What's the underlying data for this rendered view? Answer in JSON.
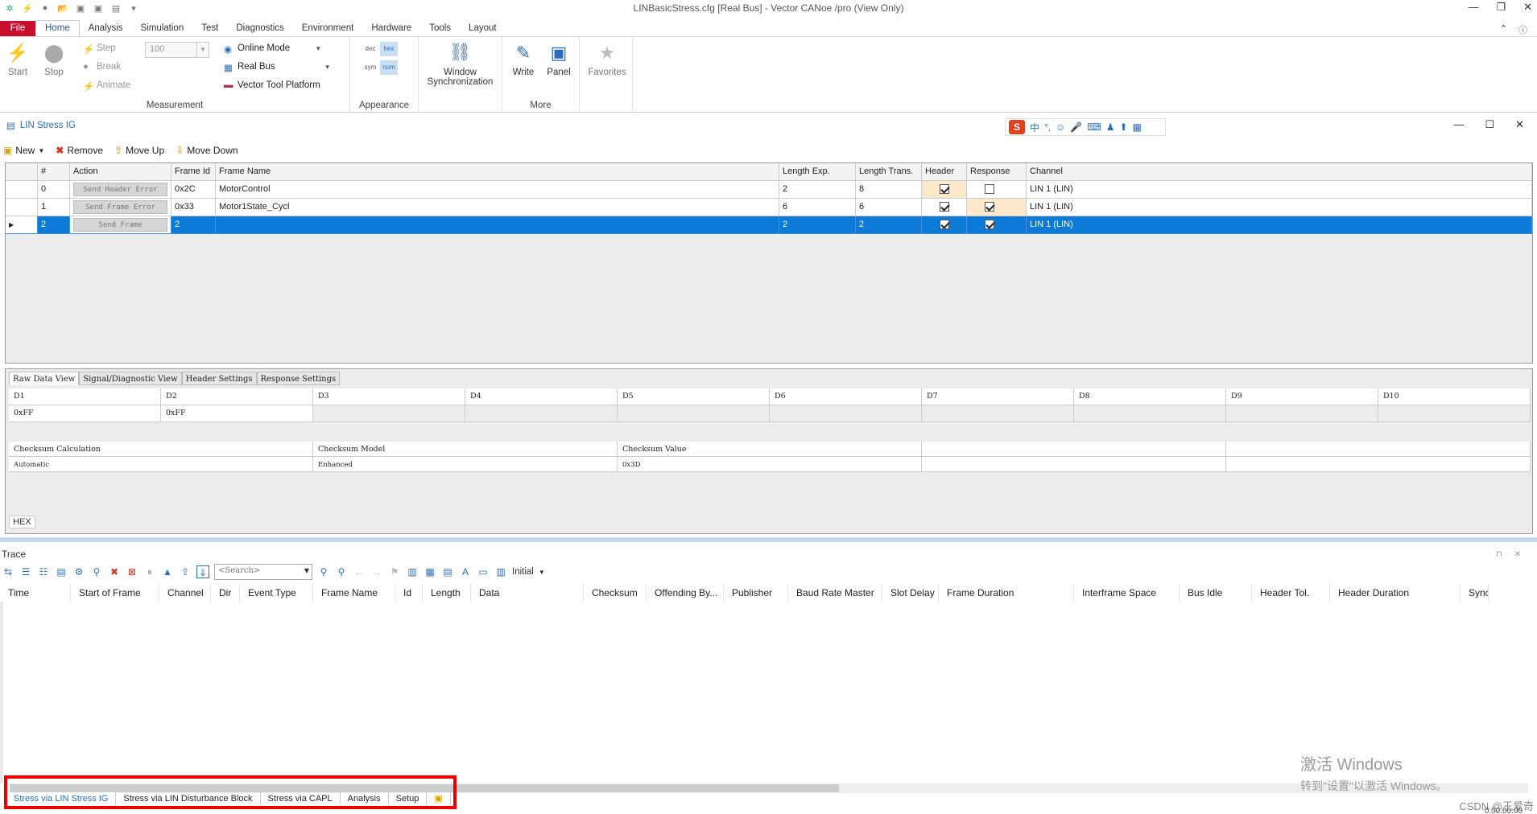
{
  "app": {
    "title": "LINBasicStress.cfg [Real Bus] - Vector CANoe /pro (View Only)",
    "window_controls": [
      "—",
      "❐",
      "✕"
    ]
  },
  "ribbon": {
    "file_tab": "File",
    "tabs": [
      "Home",
      "Analysis",
      "Simulation",
      "Test",
      "Diagnostics",
      "Environment",
      "Hardware",
      "Tools",
      "Layout"
    ],
    "active_tab": "Home",
    "measurement": {
      "start": "Start",
      "stop": "Stop",
      "step": "Step",
      "break": "Break",
      "animate": "Animate",
      "speed_value": "100",
      "online_mode": "Online Mode",
      "real_bus": "Real Bus",
      "vector_tool_platform": "Vector Tool Platform",
      "label": "Measurement"
    },
    "appearance": {
      "dec": "dec",
      "hex": "hex",
      "sym": "sym",
      "num": "num",
      "label": "Appearance"
    },
    "window_sync": {
      "line1": "Window",
      "line2": "Synchronization"
    },
    "more": {
      "write": "Write",
      "panel": "Panel",
      "label": "More"
    },
    "favorites": "Favorites"
  },
  "ig": {
    "title": "LIN Stress IG",
    "toolbar": {
      "new": "New",
      "remove": "Remove",
      "move_up": "Move Up",
      "move_down": "Move Down"
    },
    "columns": [
      "#",
      "Action",
      "Frame Id",
      "Frame Name",
      "Length Exp.",
      "Length Trans.",
      "Header",
      "Response",
      "Channel"
    ],
    "rows": [
      {
        "num": "0",
        "action": "Send Header Error",
        "frame_id": "0x2C",
        "frame_name": "MotorControl",
        "len_exp": "2",
        "len_trans": "8",
        "header": true,
        "response": false,
        "channel": "LIN 1 (LIN)"
      },
      {
        "num": "1",
        "action": "Send Frame Error",
        "frame_id": "0x33",
        "frame_name": "Motor1State_Cycl",
        "len_exp": "6",
        "len_trans": "6",
        "header": true,
        "response": true,
        "channel": "LIN 1 (LIN)"
      },
      {
        "num": "2",
        "action": "Send Frame",
        "frame_id": "2",
        "frame_name": "",
        "len_exp": "2",
        "len_trans": "2",
        "header": true,
        "response": true,
        "channel": "LIN 1 (LIN)"
      }
    ],
    "selected_row": 2
  },
  "detail": {
    "tabs": [
      "Raw Data View",
      "Signal/Diagnostic View",
      "Header Settings",
      "Response Settings"
    ],
    "active_tab": "Raw Data View",
    "data_headers": [
      "D1",
      "D2",
      "D3",
      "D4",
      "D5",
      "D6",
      "D7",
      "D8",
      "D9",
      "D10"
    ],
    "data_values": [
      "0xFF",
      "0xFF",
      "",
      "",
      "",
      "",
      "",
      "",
      "",
      ""
    ],
    "checksum_headers": [
      "Checksum Calculation",
      "Checksum Model",
      "Checksum Value"
    ],
    "checksum_values": [
      "Automatic",
      "Enhanced",
      "0x3D"
    ],
    "format": "HEX"
  },
  "trace": {
    "title": "Trace",
    "search_placeholder": "<Search>",
    "initial": "Initial",
    "columns": [
      "Time",
      "Start of Frame",
      "Channel",
      "Dir",
      "Event Type",
      "Frame Name",
      "Id",
      "Length",
      "Data",
      "Checksum",
      "Offending By...",
      "Publisher",
      "Baud Rate Master",
      "Slot Delay",
      "Frame Duration",
      "Interframe Space",
      "Bus Idle",
      "Header Tol.",
      "Header Duration",
      "Sync Br"
    ]
  },
  "bottom_tabs": [
    "Stress via LIN Stress IG",
    "Stress via LIN Disturbance Block",
    "Stress via CAPL",
    "Analysis",
    "Setup"
  ],
  "active_bottom_tab": "Stress via LIN Stress IG",
  "watermark": {
    "line1": "激活 Windows",
    "line2": "转到\"设置\"以激活 Windows。"
  },
  "csdn": "CSDN @王爱奇",
  "status_time": "0:00:00:00",
  "colors": {
    "file_tab": "#c8102e",
    "accent": "#2a6ebb",
    "selection": "#0e7ad8",
    "highlight_box": "#ee0000"
  }
}
